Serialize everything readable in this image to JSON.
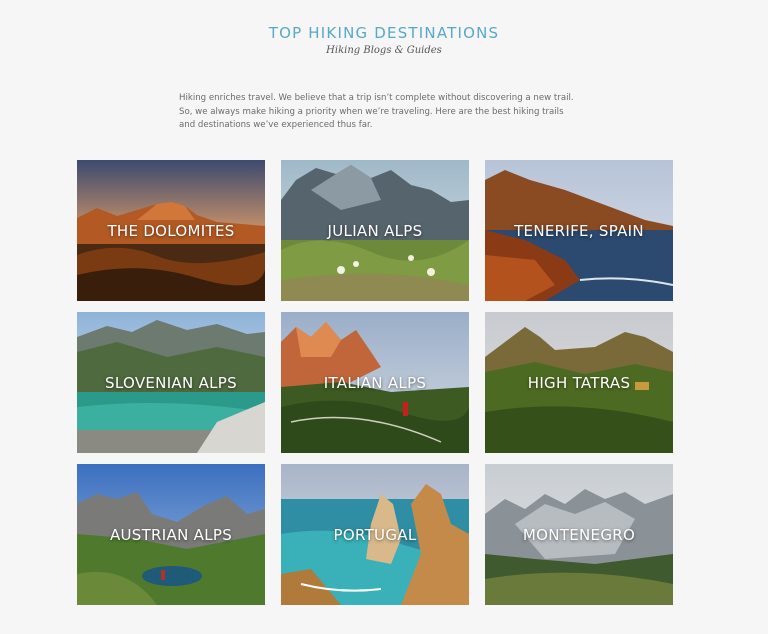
{
  "header": {
    "title": "TOP HIKING DESTINATIONS",
    "subtitle": "Hiking Blogs & Guides"
  },
  "intro": {
    "text": "Hiking enriches travel. We believe that a trip isn’t complete without discovering a new trail. So, we always make hiking a priority when we’re traveling. Here are the best hiking trails and destinations we’ve experienced thus far."
  },
  "destinations": [
    {
      "label": "THE DOLOMITES"
    },
    {
      "label": "JULIAN ALPS"
    },
    {
      "label": "TENERIFE, SPAIN"
    },
    {
      "label": "SLOVENIAN ALPS"
    },
    {
      "label": "ITALIAN ALPS"
    },
    {
      "label": "HIGH TATRAS"
    },
    {
      "label": "AUSTRIAN ALPS"
    },
    {
      "label": "PORTUGAL"
    },
    {
      "label": "MONTENEGRO"
    }
  ]
}
